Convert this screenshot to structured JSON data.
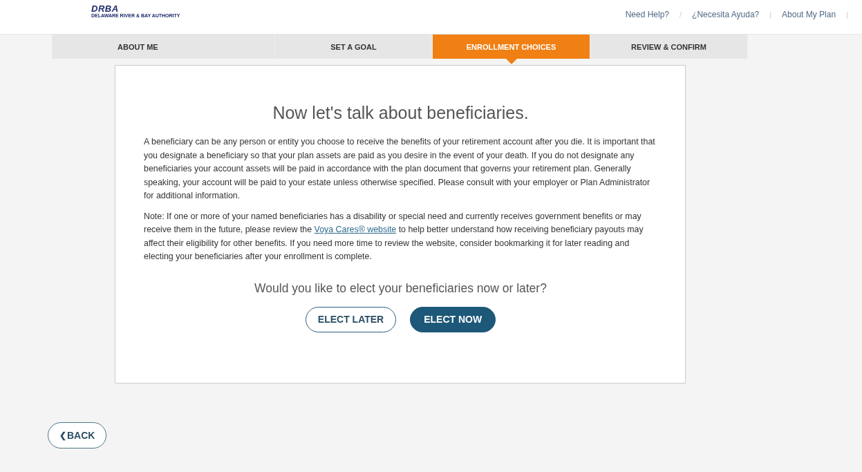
{
  "header": {
    "logo": {
      "mark": "DRBA",
      "subtitle": "DELAWARE RIVER & BAY AUTHORITY"
    },
    "links": [
      {
        "kind": "link",
        "text": "Need Help?"
      },
      {
        "kind": "separator",
        "text": "/"
      },
      {
        "kind": "link",
        "text": "¿Necesita Ayuda?"
      },
      {
        "kind": "separator",
        "text": "|"
      },
      {
        "kind": "link",
        "text": "About My Plan"
      },
      {
        "kind": "separator",
        "text": "|"
      }
    ]
  },
  "steps": [
    {
      "label": "ABOUT ME",
      "selected": false
    },
    {
      "label": "SET A GOAL",
      "selected": false
    },
    {
      "label": "ENROLLMENT CHOICES",
      "selected": true
    },
    {
      "label": "REVIEW & CONFIRM",
      "selected": false
    }
  ],
  "card": {
    "heading": "Now let's talk about beneficiaries.",
    "paragraphs": [
      {
        "before": "A beneficiary can be any person or entity you choose to receive the benefits of your retirement account after you die. It is important that you designate a beneficiary so that your plan assets are paid as you desire in the event of your death. If you do not designate any beneficiaries your account assets will be paid in accordance with the plan document that governs your retirement plan. Generally speaking, your account will be paid to your estate unless otherwise specified. Please consult with your employer or Plan Administrator for additional information."
      },
      {
        "before": "Note: If one or more of your named beneficiaries has a disability or special need and currently receives government benefits or may receive them in the future, please review the ",
        "link": "Voya Cares® website",
        "after": " to help better understand how receiving beneficiary payouts may affect their eligibility for other benefits. If you need more time to review the website, consider bookmarking it for later reading and electing your beneficiaries after your enrollment is complete."
      }
    ],
    "question": "Would you like to elect your beneficiaries now or later?",
    "buttons": [
      {
        "label": "ELECT LATER",
        "kind": "secondary"
      },
      {
        "label": "ELECT NOW",
        "kind": "primary"
      }
    ]
  },
  "back": {
    "icon": "❮",
    "label": "BACK"
  }
}
